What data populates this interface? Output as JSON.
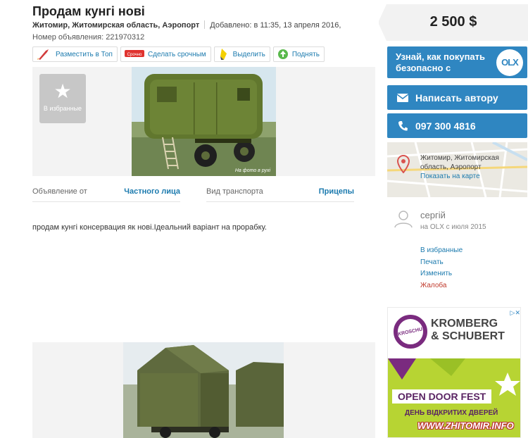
{
  "listing": {
    "title": "Продам кунгі нові",
    "location": "Житомир, Житомирская область, Аэропорт",
    "added": "Добавлено: в 11:35, 13 апреля 2016,",
    "ad_number": "Номер объявления: 221970312",
    "description": "продам кунгі консервация як нові.Ідеальний варіант на прорабку."
  },
  "actions": [
    {
      "label": "Разместить в Топ",
      "icon": "rocket-icon"
    },
    {
      "label": "Сделать срочным",
      "icon": "urgent-tag-icon",
      "tag": "Срочно"
    },
    {
      "label": "Выделить",
      "icon": "highlighter-icon"
    },
    {
      "label": "Поднять",
      "icon": "raise-icon"
    }
  ],
  "gallery": {
    "favorite_label": "В избранные",
    "photo1_watermark": "На фото в рухі"
  },
  "params": [
    {
      "key": "Объявление от",
      "value": "Частного лица"
    },
    {
      "key": "Вид транспорта",
      "value": "Прицепы"
    }
  ],
  "sidebar": {
    "price": "2 500 $",
    "learn_label": "Узнай, как покупать безопасно с",
    "olx_logo": "OLX",
    "write_label": "Написать автору",
    "phone": "097 300 4816",
    "map_address": "Житомир, Житомирская область, Аэропорт",
    "map_link": "Показать на карте",
    "user_name": "сергій",
    "user_since": "на OLX с июля 2015",
    "links": [
      "В избранные",
      "Печать",
      "Изменить",
      "Жалоба"
    ]
  },
  "ad_banner": {
    "logo_text": "KROSCHU",
    "brand_line1": "KROMBERG",
    "brand_line2": "& SCHUBERT",
    "event": "OPEN DOOR FEST",
    "event_sub": "ДЕНЬ ВІДКРИТИХ ДВЕРЕЙ",
    "site_watermark": "WWW.ZHITOMIR.INFO"
  },
  "colors": {
    "accent": "#2f86c1",
    "link": "#1b7aae",
    "ad_green": "#b7d433",
    "ad_purple": "#7a2b7f"
  }
}
